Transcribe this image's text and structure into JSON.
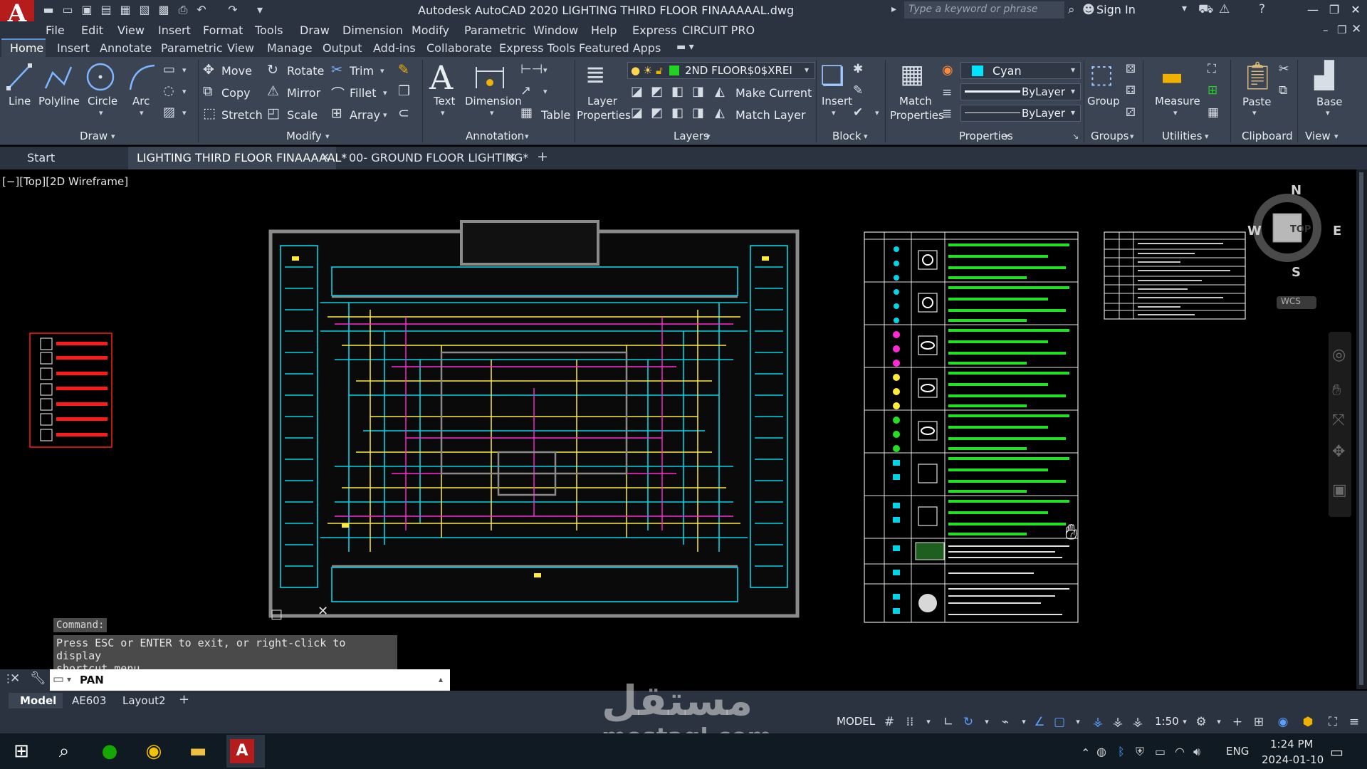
{
  "app": {
    "logo": "A",
    "title": "Autodesk AutoCAD 2020    LIGHTING THIRD FLOOR FINAAAAAL.dwg",
    "search_placeholder": "Type a keyword or phrase",
    "signin": "Sign In"
  },
  "menubar": [
    "File",
    "Edit",
    "View",
    "Insert",
    "Format",
    "Tools",
    "Draw",
    "Dimension",
    "Modify",
    "Parametric",
    "Window",
    "Help",
    "Express",
    "CIRCUIT PRO"
  ],
  "ribbon_tabs": [
    "Home",
    "Insert",
    "Annotate",
    "Parametric",
    "View",
    "Manage",
    "Output",
    "Add-ins",
    "Collaborate",
    "Express Tools",
    "Featured Apps"
  ],
  "ribbon": {
    "draw": {
      "line": "Line",
      "polyline": "Polyline",
      "circle": "Circle",
      "arc": "Arc",
      "title": "Draw"
    },
    "modify": {
      "move": "Move",
      "rotate": "Rotate",
      "trim": "Trim",
      "copy": "Copy",
      "mirror": "Mirror",
      "fillet": "Fillet",
      "stretch": "Stretch",
      "scale": "Scale",
      "array": "Array",
      "title": "Modify"
    },
    "annotation": {
      "text": "Text",
      "dimension": "Dimension",
      "table": "Table",
      "title": "Annotation"
    },
    "layers": {
      "layer_properties_1": "Layer",
      "layer_properties_2": "Properties",
      "current_layer": "2ND FLOOR$0$XREI",
      "make_current": "Make Current",
      "match_layer": "Match Layer",
      "title": "Layers"
    },
    "block": {
      "insert": "Insert",
      "title": "Block"
    },
    "properties": {
      "match_1": "Match",
      "match_2": "Properties",
      "color": "Cyan",
      "linetype": "ByLayer",
      "lineweight": "ByLayer",
      "title": "Properties"
    },
    "groups": {
      "group": "Group",
      "title": "Groups"
    },
    "utilities": {
      "measure": "Measure",
      "title": "Utilities"
    },
    "clipboard": {
      "paste": "Paste",
      "title": "Clipboard"
    },
    "view": {
      "base": "Base",
      "title": "View"
    }
  },
  "doc_tabs": [
    "Start",
    "LIGHTING THIRD FLOOR FINAAAAAL*",
    "00- GROUND FLOOR LIGHTING*"
  ],
  "viewport_label": "[−][Top][2D Wireframe]",
  "viewcube": {
    "top": "TOP",
    "n": "N",
    "s": "S",
    "e": "E",
    "w": "W",
    "wcs": "WCS"
  },
  "command": {
    "label": "Command:",
    "message_1": "Press ESC or ENTER to exit, or right-click to display",
    "message_2": "shortcut menu.",
    "input": "PAN"
  },
  "layout_tabs": [
    "Model",
    "AE603",
    "Layout2"
  ],
  "status": {
    "model": "MODEL",
    "scale": "1:50"
  },
  "taskbar": {
    "lang": "ENG",
    "time": "1:24 PM",
    "date": "2024-01-10"
  },
  "watermark": {
    "arabic": "مستقل",
    "latin": "mostaql.com"
  },
  "colors": {
    "cyan": "#00e5ff",
    "yellow": "#ffeb3b",
    "magenta": "#ff2bd6",
    "green": "#22e022",
    "red": "#ff1a1a"
  }
}
